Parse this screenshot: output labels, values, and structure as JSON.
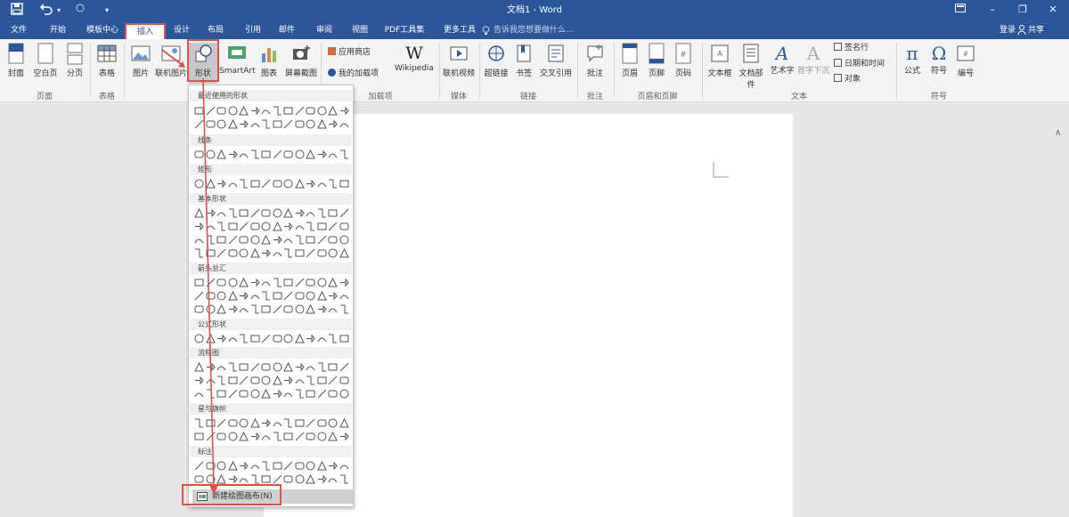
{
  "titlebar": {
    "save_icon": "save-icon",
    "undo_icon": "undo-icon",
    "redo_icon": "redo-icon",
    "customize_icon": "customize-qat-icon",
    "title": "文档1 - Word",
    "ribbon_options_icon": "ribbon-display-options-icon",
    "minimize_glyph": "–",
    "restore_glyph": "❐",
    "close_glyph": "✕"
  },
  "menu": {
    "items": [
      "文件",
      "开始",
      "模板中心",
      "插入",
      "设计",
      "布局",
      "引用",
      "邮件",
      "审阅",
      "视图",
      "PDF工具集",
      "更多工具"
    ],
    "active": "插入",
    "tellme": "告诉我您想要做什么...",
    "login": "登录",
    "share": "共享"
  },
  "ribbon": {
    "pages": {
      "cover": "封面",
      "blank": "空白页",
      "pagebreak": "分页",
      "label": "页面"
    },
    "tables": {
      "table": "表格",
      "label": "表格"
    },
    "illustrations": {
      "picture": "图片",
      "online_picture": "联机图片",
      "shapes": "形状",
      "smartart": "SmartArt",
      "chart": "图表",
      "screenshot": "屏幕截图"
    },
    "addins": {
      "store": "应用商店",
      "my_addins": "我的加载项",
      "wikipedia": "Wikipedia",
      "wikipedia_glyph": "W",
      "label": "加载项"
    },
    "media": {
      "online_video": "联机视频",
      "label": "媒体"
    },
    "links": {
      "hyperlink": "超链接",
      "bookmark": "书签",
      "crossref": "交叉引用",
      "label": "链接"
    },
    "comments": {
      "comment": "批注",
      "label": "批注"
    },
    "headerfooter": {
      "header": "页眉",
      "footer": "页脚",
      "pagenum": "页码",
      "label": "页眉和页脚"
    },
    "text": {
      "textbox": "文本框",
      "quickparts": "文档部件",
      "wordart": "艺术字",
      "dropcap": "首字下沉",
      "sigline": "签名行",
      "datetime": "日期和时间",
      "object": "对象",
      "label": "文本"
    },
    "symbols": {
      "equation": "公式",
      "equation_glyph": "π",
      "symbol": "符号",
      "symbol_glyph": "Ω",
      "number": "编号",
      "label": "符号"
    }
  },
  "shapes_dropdown": {
    "sections": [
      "最近使用的形状",
      "线条",
      "矩形",
      "基本形状",
      "箭头总汇",
      "公式形状",
      "流程图",
      "星与旗帜",
      "标注"
    ],
    "new_canvas": "新建绘图画布(N)"
  },
  "collapse_glyph": "∧",
  "colors": {
    "accent": "#2b579a",
    "highlight": "#d9534f"
  }
}
